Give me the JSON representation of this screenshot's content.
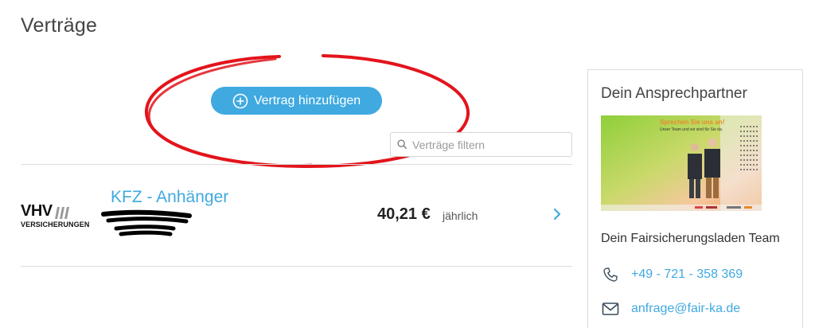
{
  "page": {
    "title": "Verträge"
  },
  "actions": {
    "add_contract_label": "Vertrag hinzufügen"
  },
  "filter": {
    "placeholder": "Verträge filtern"
  },
  "contracts": [
    {
      "insurer": {
        "logo_main": "VHV",
        "logo_sub": "VERSICHERUNGEN"
      },
      "title": "KFZ - Anhänger",
      "price": "40,21 €",
      "period": "jährlich"
    }
  ],
  "contact": {
    "heading": "Dein Ansprechpartner",
    "banner_headline": "Sprechen Sie uns an!",
    "banner_subline": "Unser Team und wir sind für Sie da.",
    "team_name": "Dein Fairsicherungsladen Team",
    "phone": "+49 - 721 - 358 369",
    "email": "anfrage@fair-ka.de"
  },
  "colors": {
    "accent": "#3fa9e0",
    "annotation_red": "#e3141c"
  },
  "icons": [
    "plus-circle-icon",
    "search-icon",
    "chevron-right-icon",
    "phone-icon",
    "mail-icon"
  ]
}
